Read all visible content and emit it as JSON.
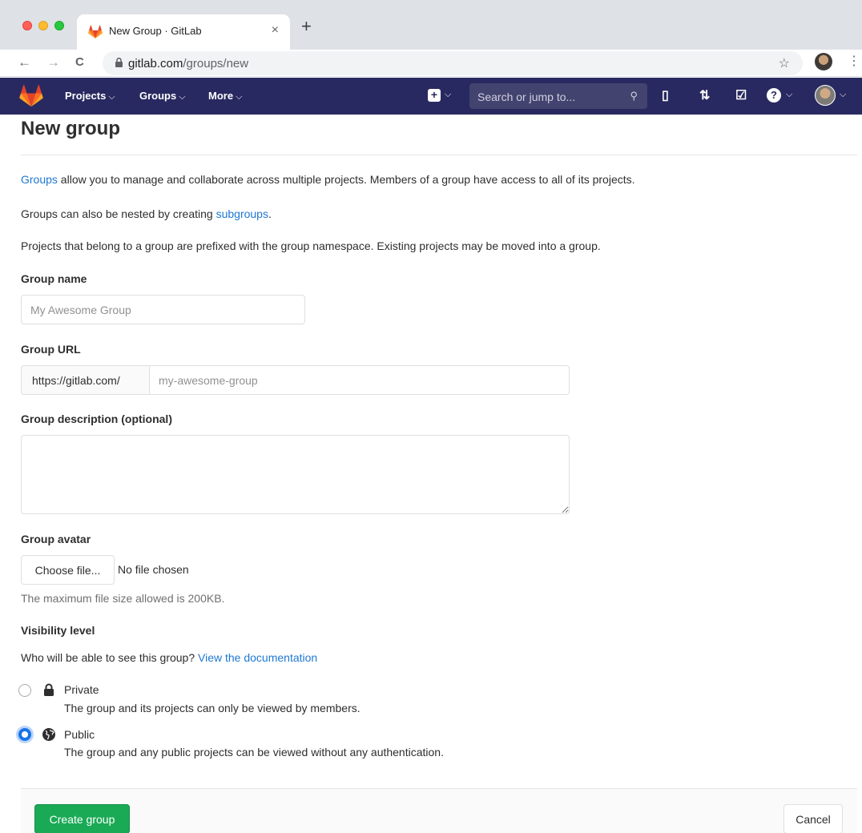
{
  "browser": {
    "tab_title": "New Group · GitLab",
    "tab_close": "×",
    "new_tab": "+",
    "url_host": "gitlab.com",
    "url_path": "/groups/new",
    "back": "←",
    "forward": "→",
    "reload": "C",
    "star": "☆",
    "menu": "⋮"
  },
  "navbar": {
    "items": [
      {
        "label": "Projects",
        "chevron": "⌵"
      },
      {
        "label": "Groups",
        "chevron": "⌵"
      },
      {
        "label": "More",
        "chevron": "⌵"
      }
    ],
    "new_button_label": "+",
    "new_chevron": "⌵",
    "search_placeholder": "Search or jump to...",
    "search_icon": "⚲",
    "icons": {
      "issues": "▯",
      "merge_requests": "⇅",
      "todos": "☑",
      "help": "?"
    },
    "colors": {
      "background": "#292961",
      "search": "#43436f"
    }
  },
  "page": {
    "title": "New group",
    "intro": {
      "groups_link": "Groups",
      "line1_rest": " allow you to manage and collaborate across multiple projects. Members of a group have access to all of its projects.",
      "line2_prefix": "Groups can also be nested by creating ",
      "subgroups_link": "subgroups",
      "line2_suffix": ".",
      "line3": "Projects that belong to a group are prefixed with the group namespace. Existing projects may be moved into a group."
    },
    "group_name": {
      "label": "Group name",
      "placeholder": "My Awesome Group",
      "value": ""
    },
    "group_url": {
      "label": "Group URL",
      "prefix": "https://gitlab.com/",
      "placeholder": "my-awesome-group",
      "value": ""
    },
    "description": {
      "label": "Group description (optional)",
      "value": ""
    },
    "avatar": {
      "label": "Group avatar",
      "button_label": "Choose file...",
      "status": "No file chosen",
      "help": "The maximum file size allowed is 200KB."
    },
    "visibility": {
      "label": "Visibility level",
      "question": "Who will be able to see this group? ",
      "doc_link": "View the documentation",
      "options": [
        {
          "icon": "lock-icon",
          "title": "Private",
          "description": "The group and its projects can only be viewed by members.",
          "selected": false
        },
        {
          "icon": "globe-icon",
          "title": "Public",
          "description": "The group and any public projects can be viewed without any authentication.",
          "selected": true
        }
      ]
    },
    "actions": {
      "create": "Create group",
      "cancel": "Cancel"
    },
    "colors": {
      "link": "#1f78d1",
      "primary": "#1aaa55"
    }
  }
}
